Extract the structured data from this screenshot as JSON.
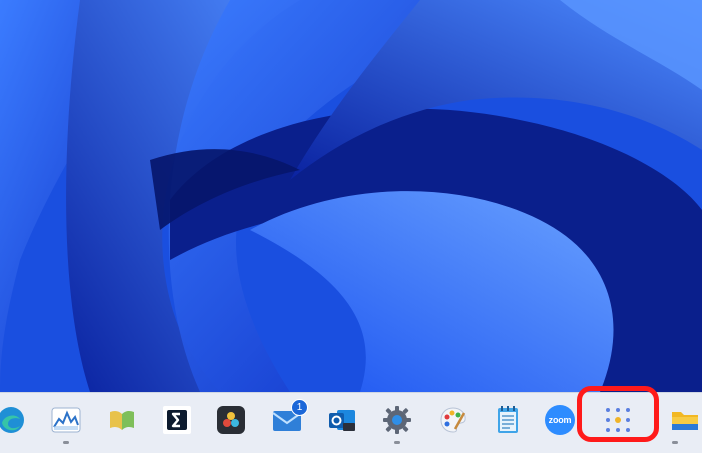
{
  "desktop": {
    "wallpaper": "windows-11-bloom-blue"
  },
  "taskbar": {
    "apps": [
      {
        "id": "edge",
        "icon": "edge-icon"
      },
      {
        "id": "task-manager",
        "icon": "task-manager-icon",
        "running": true
      },
      {
        "id": "book-app",
        "icon": "open-book-icon"
      },
      {
        "id": "app-s",
        "icon": "s-logo-icon"
      },
      {
        "id": "davinci-resolve",
        "icon": "davinci-resolve-icon"
      },
      {
        "id": "mail",
        "icon": "mail-icon",
        "badge": "1"
      },
      {
        "id": "outlook",
        "icon": "outlook-icon"
      },
      {
        "id": "settings",
        "icon": "gear-icon",
        "running": true
      },
      {
        "id": "paint",
        "icon": "paint-palette-icon"
      },
      {
        "id": "notepad",
        "icon": "notepad-icon"
      },
      {
        "id": "zoom",
        "icon": "zoom-icon",
        "label": "zoom"
      },
      {
        "id": "start-apps-grid",
        "icon": "dots-grid-icon",
        "highlighted": true
      },
      {
        "id": "file-explorer",
        "icon": "folder-icon",
        "running": true
      }
    ],
    "mail_badge": "1",
    "zoom_label": "zoom"
  },
  "colors": {
    "taskbar_bg": "#e9edf5",
    "highlight": "#ff1a1a",
    "wallpaper_dark": "#0b1d78",
    "wallpaper_light": "#2a6df3"
  }
}
